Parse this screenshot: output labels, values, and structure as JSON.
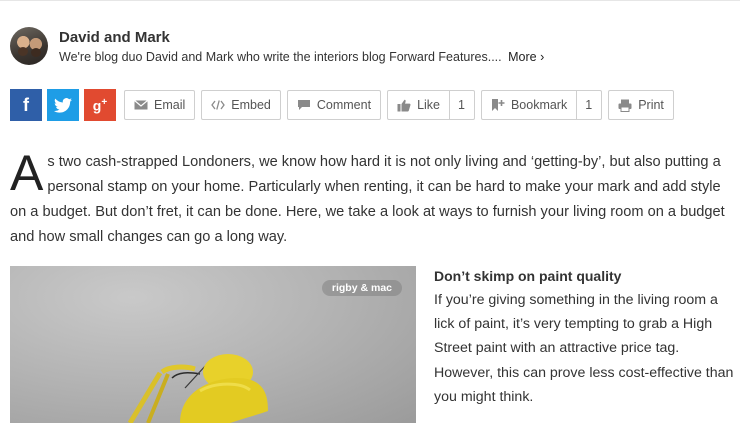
{
  "author": {
    "name": "David and Mark",
    "bio": "We're blog duo David and Mark who write the interiors blog Forward Features....",
    "more": "More ›"
  },
  "share": {
    "facebook": "f",
    "google": "g",
    "google_plus": "+",
    "email": "Email",
    "embed": "Embed",
    "comment": "Comment",
    "like": "Like",
    "like_count": "1",
    "bookmark": "Bookmark",
    "bookmark_count": "1",
    "print": "Print"
  },
  "icons": {
    "facebook": "facebook-icon",
    "twitter": "twitter-icon",
    "google_plus": "google-plus-icon",
    "email": "envelope-icon",
    "embed": "code-icon",
    "comment": "speech-bubble-icon",
    "like": "thumbs-up-icon",
    "bookmark": "bookmark-plus-icon",
    "print": "printer-icon"
  },
  "colors": {
    "facebook": "#2f5fa8",
    "twitter": "#1e9de6",
    "google_plus": "#e14a30",
    "lamp": "#e8d12a"
  },
  "article": {
    "dropcap": "A",
    "intro": "s two cash-strapped Londoners, we know how hard it is not only living and ‘getting-by’, but also putting a personal stamp on your home. Particularly when renting, it can be hard to make your mark and add style on a budget. But don’t fret, it can be done. Here, we take a look at ways to furnish your living room on a budget and how small changes can go a long way.",
    "photo_credit": "rigby & mac",
    "section_title": "Don’t skimp on paint quality",
    "section_text": "If you’re giving something in the living room a lick of paint, it’s very tempting to grab a High Street paint with an attractive price tag. However, this can prove less cost-effective than you might think."
  }
}
